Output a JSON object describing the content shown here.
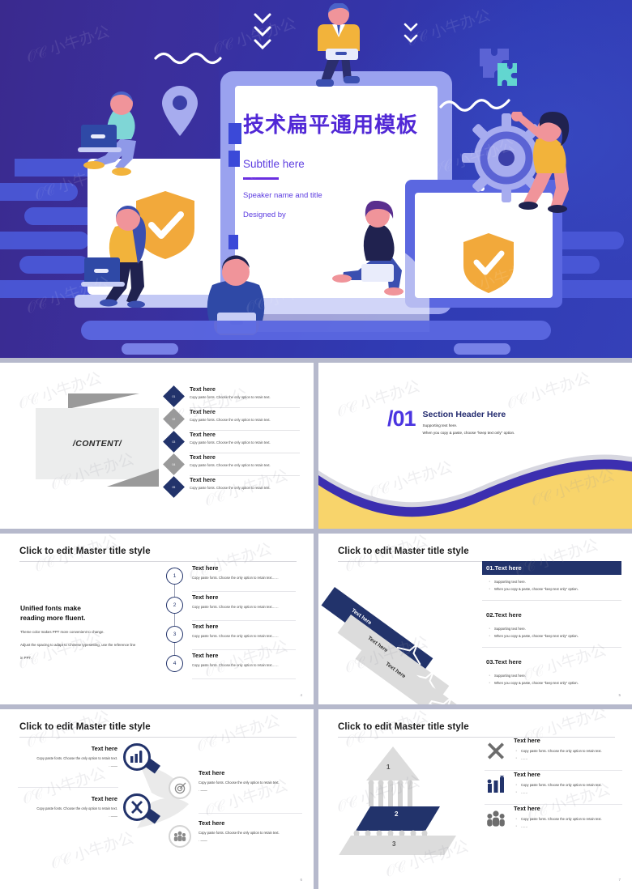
{
  "deck": {
    "hero": {
      "title": "技术扁平通用模板",
      "subtitle": "Subtitle here",
      "speaker": "Speaker name and title",
      "designed": "Designed by",
      "colors": {
        "bg_from": "#3c2a92",
        "bg_to": "#3540b8",
        "title_color": "#5128d6",
        "accent_violet": "#6a2fe0",
        "shield_gold": "#F2A93B",
        "device_lilac": "#9aa2ef",
        "blob_blue": "#4a57d6"
      },
      "icons": [
        "location-pin-icon",
        "gear-icon",
        "shield-check-icon",
        "puzzle-icon",
        "chevron-down-icon",
        "squiggle-icon",
        "laptop-icon",
        "cloud-icon"
      ]
    },
    "slide_content": {
      "banner_label": "/CONTENT/",
      "items": [
        {
          "num": "01",
          "heading": "Text here",
          "body": "Copy paste fonts. Choose the only option to retain text.",
          "color": "#22336b"
        },
        {
          "num": "02",
          "heading": "Text here",
          "body": "Copy paste fonts. Choose the only option to retain text.",
          "color": "#9a9a9a"
        },
        {
          "num": "03",
          "heading": "Text here",
          "body": "Copy paste fonts. Choose the only option to retain text.",
          "color": "#22336b"
        },
        {
          "num": "04",
          "heading": "Text here",
          "body": "Copy paste fonts. Choose the only option to retain text.",
          "color": "#9a9a9a"
        },
        {
          "num": "05",
          "heading": "Text here",
          "body": "Copy paste fonts. Choose the only option to retain text.",
          "color": "#22336b"
        }
      ]
    },
    "slide_section": {
      "number": "/01",
      "heading": "Section Header Here",
      "support_1": "Supporting text here.",
      "support_2": "When you copy & paste, choose \"keep text only\" option.",
      "wave_yellow": "#F8D46B",
      "wave_purple": "#3C2FB0"
    },
    "slide_steps": {
      "title": "Click to edit Master title style",
      "lead_heading_1": "Unified fonts make",
      "lead_heading_2": "reading more fluent.",
      "lead_body_1": "Theme color makes PPT more convenient to change.",
      "lead_body_2": "Adjust the spacing to adapt to Chinese typesetting, use the reference line",
      "lead_body_3": "in PPT.",
      "page": "4",
      "steps": [
        {
          "num": "1",
          "heading": "Text here",
          "body": "Copy paste fonts. Choose the only option to retain text……"
        },
        {
          "num": "2",
          "heading": "Text here",
          "body": "Copy paste fonts. Choose the only option to retain text……"
        },
        {
          "num": "3",
          "heading": "Text here",
          "body": "Copy paste fonts. Choose the only option to retain text……"
        },
        {
          "num": "4",
          "heading": "Text here",
          "body": "Copy paste fonts. Choose the only option to retain text……"
        }
      ]
    },
    "slide_ribbon": {
      "title": "Click to edit Master title style",
      "page": "5",
      "ribbons": [
        {
          "label": "Text here",
          "fill": "#22336b",
          "text_color": "#ffffff"
        },
        {
          "label": "Text here",
          "fill": "#dcdcdc",
          "text_color": "#333333"
        },
        {
          "label": "Text here",
          "fill": "#dcdcdc",
          "text_color": "#333333"
        }
      ],
      "blocks": [
        {
          "heading": "01.Text here",
          "highlight": true,
          "bullets": [
            "Supporting text here.",
            "When you copy & paste, choose \"keep text only\" option."
          ]
        },
        {
          "heading": "02.Text here",
          "highlight": false,
          "bullets": [
            "Supporting text here.",
            "When you copy & paste, choose \"keep text only\" option."
          ]
        },
        {
          "heading": "03.Text here",
          "highlight": false,
          "bullets": [
            "Supporting text here.",
            "When you copy & paste, choose \"keep text only\" option."
          ]
        }
      ]
    },
    "slide_magnifier": {
      "title": "Click to edit Master title style",
      "page": "6",
      "nodes": [
        {
          "heading": "Text here",
          "body": "Copy paste fonts. Choose the only option to retain text.",
          "icon": "bar-chart-icon",
          "accent": "#22336b",
          "side": "left"
        },
        {
          "heading": "Text here",
          "body": "Copy paste fonts. Choose the only option to retain text.",
          "icon": "target-icon",
          "accent": "#cfcfcf",
          "side": "right"
        },
        {
          "heading": "Text here",
          "body": "Copy paste fonts. Choose the only option to retain text.",
          "icon": "tools-icon",
          "accent": "#22336b",
          "side": "left"
        },
        {
          "heading": "Text here",
          "body": "Copy paste fonts. Choose the only option to retain text.",
          "icon": "people-icon",
          "accent": "#cfcfcf",
          "side": "right"
        }
      ]
    },
    "slide_pyramid": {
      "title": "Click to edit Master title style",
      "page": "7",
      "levels": [
        {
          "label": "1",
          "fill": "#dcdcdc"
        },
        {
          "label": "2",
          "fill": "#22336b"
        },
        {
          "label": "3",
          "fill": "#dcdcdc"
        }
      ],
      "rows": [
        {
          "icon": "tools-icon",
          "accent": "#6d6d6d",
          "heading": "Text here",
          "bullets": [
            "Copy paste fonts. Choose the only option to retain text.",
            "……"
          ]
        },
        {
          "icon": "bar-chart-icon",
          "accent": "#22336b",
          "heading": "Text here",
          "bullets": [
            "Copy paste fonts. Choose the only option to retain text.",
            "……"
          ]
        },
        {
          "icon": "people-icon",
          "accent": "#6d6d6d",
          "heading": "Text here",
          "bullets": [
            "Copy paste fonts. Choose the only option to retain text.",
            "……"
          ]
        }
      ]
    },
    "watermark": "小牛办公"
  }
}
